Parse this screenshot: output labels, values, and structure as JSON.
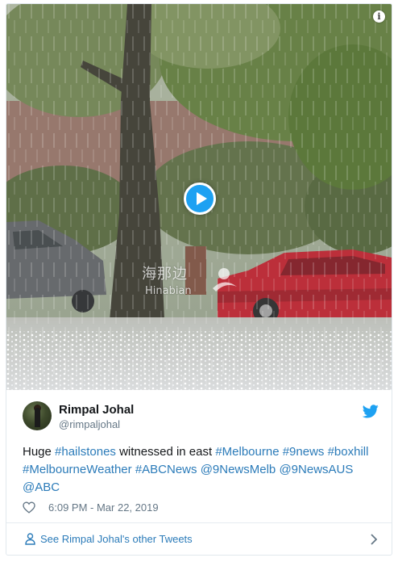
{
  "media": {
    "watermark_cn": "海那边",
    "watermark_en": "Hinabian",
    "info_icon": "info-icon",
    "play_icon": "play-icon"
  },
  "author": {
    "name": "Rimpal Johal",
    "handle": "@rimpaljohal",
    "avatar_icon": "avatar"
  },
  "tweet": {
    "segments": [
      {
        "text": "Huge ",
        "type": "text"
      },
      {
        "text": "#hailstones",
        "type": "link"
      },
      {
        "text": " witnessed in east ",
        "type": "text"
      },
      {
        "text": "#Melbourne",
        "type": "link"
      },
      {
        "text": " ",
        "type": "text"
      },
      {
        "text": "#9news",
        "type": "link"
      },
      {
        "text": " ",
        "type": "text"
      },
      {
        "text": "#boxhill",
        "type": "link"
      },
      {
        "text": " ",
        "type": "text"
      },
      {
        "text": "#MelbourneWeather",
        "type": "link"
      },
      {
        "text": " ",
        "type": "text"
      },
      {
        "text": "#ABCNews",
        "type": "link"
      },
      {
        "text": " ",
        "type": "text"
      },
      {
        "text": "@9NewsMelb",
        "type": "link"
      },
      {
        "text": " ",
        "type": "text"
      },
      {
        "text": "@9NewsAUS",
        "type": "link"
      },
      {
        "text": " ",
        "type": "text"
      },
      {
        "text": "@ABC",
        "type": "link"
      }
    ],
    "timestamp": "6:09 PM - Mar 22, 2019"
  },
  "footer": {
    "see_more_label": "See Rimpal Johal's other Tweets"
  },
  "colors": {
    "link": "#2b7bb9",
    "twitter_blue": "#1da1f2",
    "secondary_text": "#657786"
  }
}
